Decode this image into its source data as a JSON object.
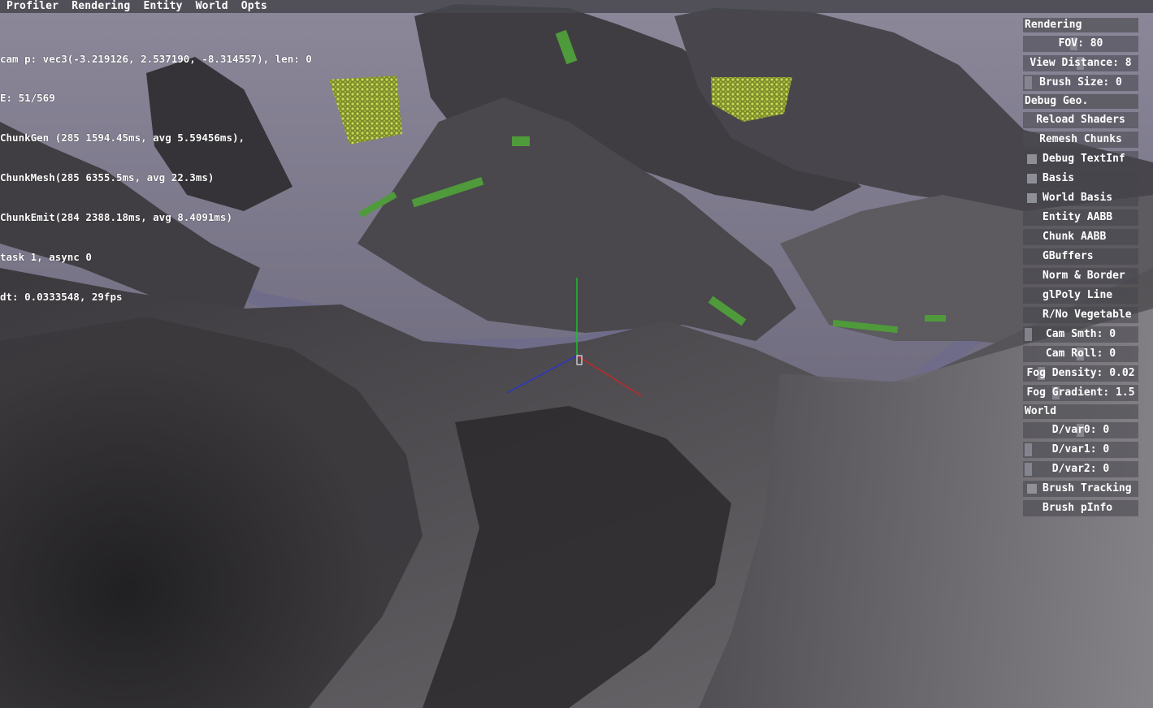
{
  "menu": [
    "Profiler",
    "Rendering",
    "Entity",
    "World",
    "Opts"
  ],
  "hud": {
    "cam": "cam p: vec3(-3.219126, 2.537190, -8.314557), len: 0",
    "entities": "E: 51/569",
    "chunk_gen": "ChunkGen (285 1594.45ms, avg 5.59456ms),",
    "chunk_mesh": "ChunkMesh(285 6355.5ms, avg 22.3ms)",
    "chunk_emit": "ChunkEmit(284 2388.18ms, avg 8.4091ms)",
    "task": "task 1, async 0",
    "dt": "dt: 0.0333548, 29fps"
  },
  "panel": {
    "rendering_header": "Rendering",
    "fov": "FOV: 80",
    "view_distance": "View Distance: 8",
    "brush_size": "Brush Size: 0",
    "debug_geo_header": "Debug Geo.",
    "reload_shaders": "Reload Shaders",
    "remesh_chunks": "Remesh Chunks",
    "debug_textinf": "Debug TextInf",
    "basis": "Basis",
    "world_basis": "World Basis",
    "entity_aabb": "Entity AABB",
    "chunk_aabb": "Chunk AABB",
    "gbuffers": "GBuffers",
    "norm_border": "Norm & Border",
    "glpoly_line": "glPoly Line",
    "rno_vegetable": "R/No Vegetable",
    "cam_smth": "Cam Smth: 0",
    "cam_roll": "Cam Roll: 0",
    "fog_density": "Fog Density: 0.02",
    "fog_gradient": "Fog Gradient: 1.5",
    "world_header": "World",
    "dvar0": "D/var0: 0",
    "dvar1": "D/var1: 0",
    "dvar2": "D/var2: 0",
    "brush_tracking": "Brush Tracking",
    "brush_pinfo": "Brush pInfo"
  },
  "colors": {
    "sky": "#6e6a7e",
    "terrain_dark": "#2a282b",
    "terrain_light": "#7d7a7f",
    "water": "#6f6c8a",
    "foliage": "#b6c84a",
    "axis_x": "#c0282a",
    "axis_y": "#19c02a",
    "axis_z": "#2a36c8"
  }
}
